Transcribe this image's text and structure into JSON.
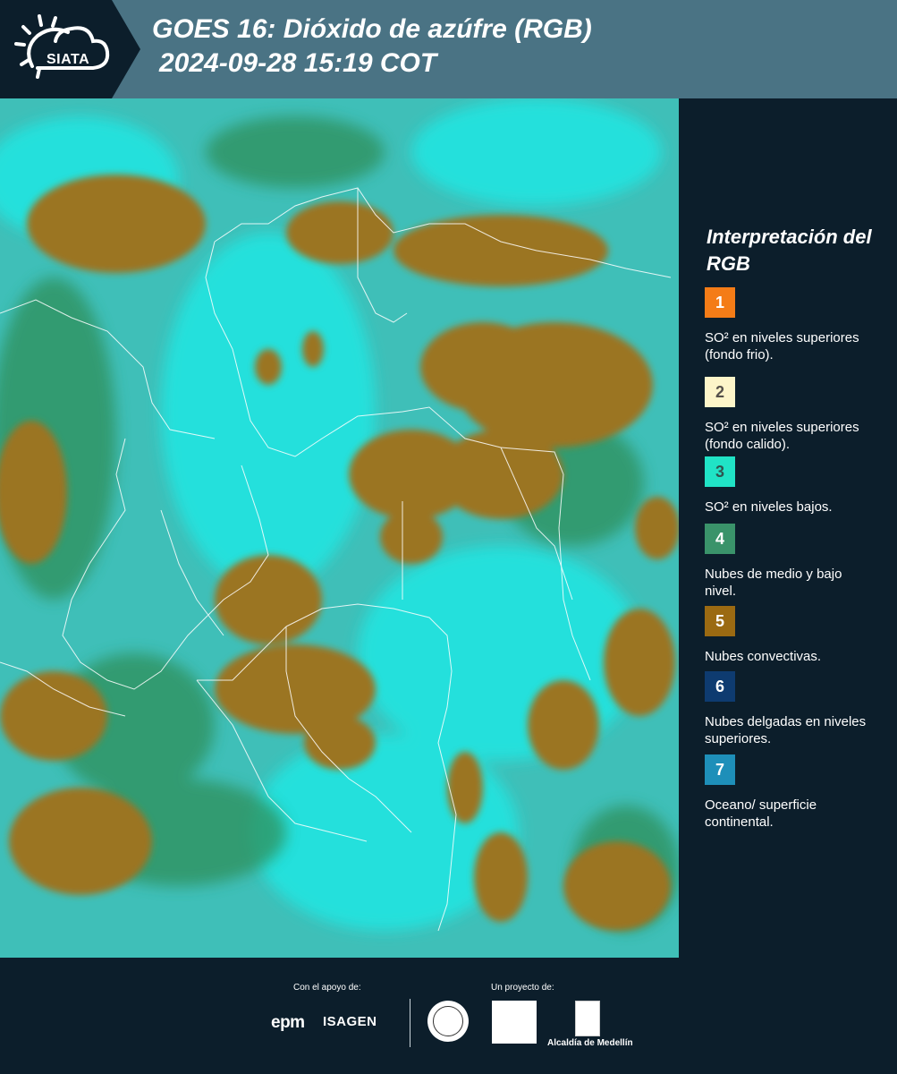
{
  "header": {
    "logo_text": "SIATA",
    "title_line1": "GOES 16: Dióxido de azúfre (RGB)",
    "title_line2": "2024-09-28 15:19 COT",
    "band_color": "#4a7384"
  },
  "legend": {
    "title": "Interpretación del RGB",
    "items": [
      {
        "number": "1",
        "color": "#f47c17",
        "text_color": "#ffffff",
        "label": "SO² en niveles superiores (fondo frio)."
      },
      {
        "number": "2",
        "color": "#fdf5c9",
        "text_color": "#55504a",
        "label": "SO² en niveles superiores (fondo calido)."
      },
      {
        "number": "3",
        "color": "#20e3c6",
        "text_color": "#2f5550",
        "label": "SO² en niveles bajos."
      },
      {
        "number": "4",
        "color": "#3a936a",
        "text_color": "#ffffff",
        "label": "Nubes de medio y bajo nivel."
      },
      {
        "number": "5",
        "color": "#9b6a12",
        "text_color": "#ffffff",
        "label": "Nubes convectivas."
      },
      {
        "number": "6",
        "color": "#0e3b70",
        "text_color": "#ffffff",
        "label": "Nubes delgadas en niveles superiores."
      },
      {
        "number": "7",
        "color": "#1e8fb9",
        "text_color": "#ffffff",
        "label": "Oceano/ superficie continental."
      }
    ]
  },
  "footer": {
    "support_label": "Con el apoyo de:",
    "project_label": "Un proyecto de:",
    "epm": "epm",
    "isagen": "ISAGEN",
    "alcaldia": "Alcaldía de Medellín"
  }
}
